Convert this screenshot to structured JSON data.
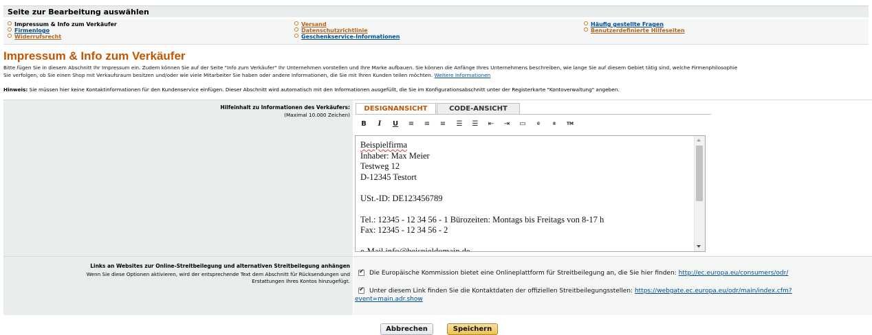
{
  "section_chooser": {
    "title": "Seite zur Bearbeitung auswählen",
    "col1": [
      "Impressum & Info zum Verkäufer",
      "Firmenlogo",
      "Widerrufsrecht"
    ],
    "col2": [
      "Versand",
      "Datenschutzrichtlinie",
      "Geschenkservice-Informationen"
    ],
    "col3": [
      "Häufig gestellte Fragen",
      "Benutzerdefinierte Hilfeseiten"
    ]
  },
  "page": {
    "title": "Impressum & Info zum Verkäufer",
    "intro_line1": "Bitte fügen Sie in diesem Abschnitt Ihr Impressum ein. Zudem können Sie auf der Seite \"Info zum Verkäufer\" Ihr Unternehmen vorstellen und Ihre Marke aufbauen. Sie können die Anfänge Ihres Unternehmens beschreiben, wie lange Sie auf diesem Gebiet tätig sind, welche Firmenphilosophie",
    "intro_line2": "Sie verfolgen, ob Sie einen Shop mit Verkaufsraum besitzen und/oder wie viele Mitarbeiter Sie haben oder andere Informationen, die Sie mit Ihren Kunden teilen möchten.",
    "intro_more": "Weitere Informationen",
    "hint_label": "Hinweis:",
    "hint_text": "Sie müssen hier keine Kontaktinformationen für den Kundenservice einfügen. Dieser Abschnitt wird automatisch mit den Informationen ausgefüllt, die Sie im Konfigurationsabschnitt unter der Registerkarte \"Kontoverwaltung\" angeben."
  },
  "editor_field": {
    "label": "Hilfeinhalt zu Informationen des Verkäufers:",
    "sublabel": "(Maximal 10.000 Zeichen)",
    "tab_design": "DESIGNANSICHT",
    "tab_code": "CODE-ANSICHT",
    "toolbar": [
      {
        "glyph": "B",
        "icon": "bold-icon"
      },
      {
        "glyph": "I",
        "icon": "italic-icon"
      },
      {
        "glyph": "U",
        "icon": "underline-icon"
      },
      {
        "glyph": "≡",
        "icon": "align-left-icon"
      },
      {
        "glyph": "≡",
        "icon": "align-center-icon"
      },
      {
        "glyph": "≡",
        "icon": "align-right-icon"
      },
      {
        "glyph": "☰",
        "icon": "ordered-list-icon"
      },
      {
        "glyph": "☰",
        "icon": "unordered-list-icon"
      },
      {
        "glyph": "⇤",
        "icon": "outdent-icon"
      },
      {
        "glyph": "⇥",
        "icon": "indent-icon"
      },
      {
        "glyph": "▭",
        "icon": "horizontal-rule-icon"
      },
      {
        "glyph": "©",
        "icon": "copyright-icon"
      },
      {
        "glyph": "®",
        "icon": "registered-icon"
      },
      {
        "glyph": "TM",
        "icon": "trademark-icon"
      }
    ],
    "content": {
      "l1": "Beispielfirma",
      "l2": "Inhaber: Max Meier",
      "l3": "Testweg 12",
      "l4": "D-12345 Testort",
      "l5": "USt.-ID: DE123456789",
      "l6": "Tel.: 12345 - 12 34 56 - 1   Bürozeiten: Montags bis Freitags von 8-17 h",
      "l7": "Fax: 12345 - 12 34 56 - 2",
      "l8": "e-Mail info@beispieldomain.de"
    }
  },
  "odr_field": {
    "label": "Links an Websites zur Online-Streitbeilegung und alternativen Streitbeilegung anhängen",
    "sub1": "Wenn Sie diese Optionen aktivieren, wird der entsprechende Text dem Abschnitt für Rücksendungen und",
    "sub2": "Erstattungen Ihres Kontos hinzugefügt.",
    "option1_text": "Die Europäische Kommission bietet eine Onlineplattform für Streitbeilegung an, die Sie hier finden:",
    "option1_link": "http://ec.europa.eu/consumers/odr/",
    "option2_text": "Unter diesem Link finden Sie die Kontaktdaten der offiziellen Streitbeilegungsstellen:",
    "option2_link_a": "https://webgate.ec.europa.eu/odr/main/index.cfm?",
    "option2_link_b": "event=main.adr.show"
  },
  "buttons": {
    "cancel": "Abbrechen",
    "save": "Speichern"
  },
  "colors": {
    "accent": "#c45500",
    "link": "#004b91",
    "panel": "#eaeded"
  }
}
